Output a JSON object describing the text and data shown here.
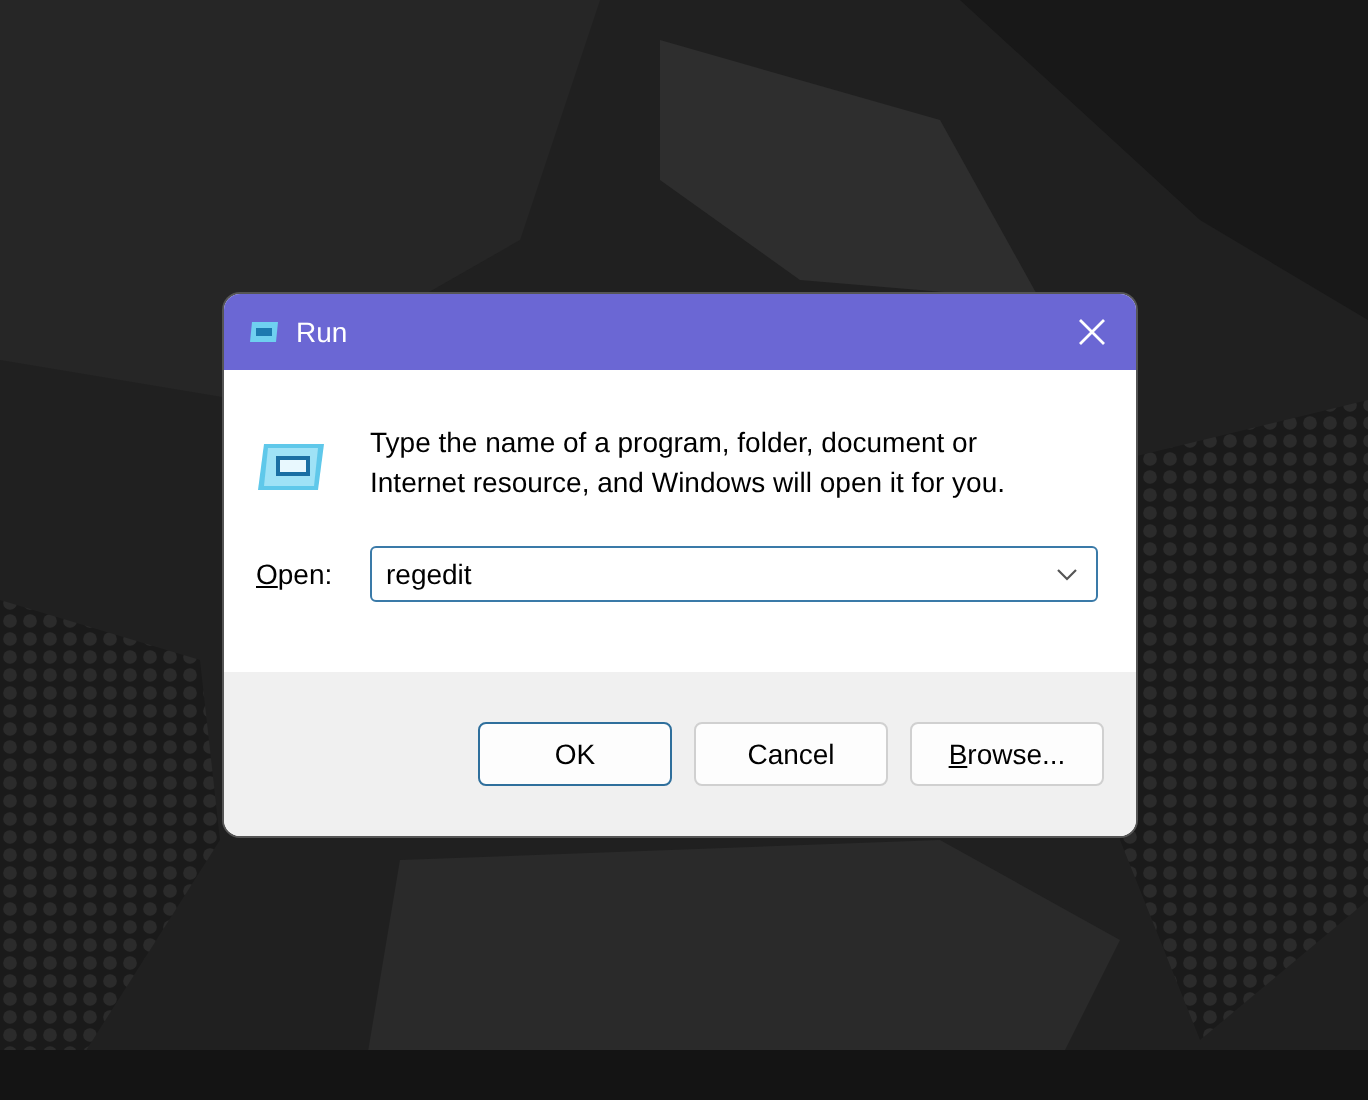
{
  "window": {
    "title": "Run"
  },
  "message": "Type the name of a program, folder, document or\nInternet resource, and Windows will open it for you.",
  "open_field": {
    "access_key": "O",
    "label": "pen:",
    "value": "regedit"
  },
  "buttons": [
    {
      "text": "OK",
      "default": true
    },
    {
      "text": "Cancel",
      "default": false
    },
    {
      "access_key": "B",
      "text": "rowse...",
      "default": false
    }
  ]
}
